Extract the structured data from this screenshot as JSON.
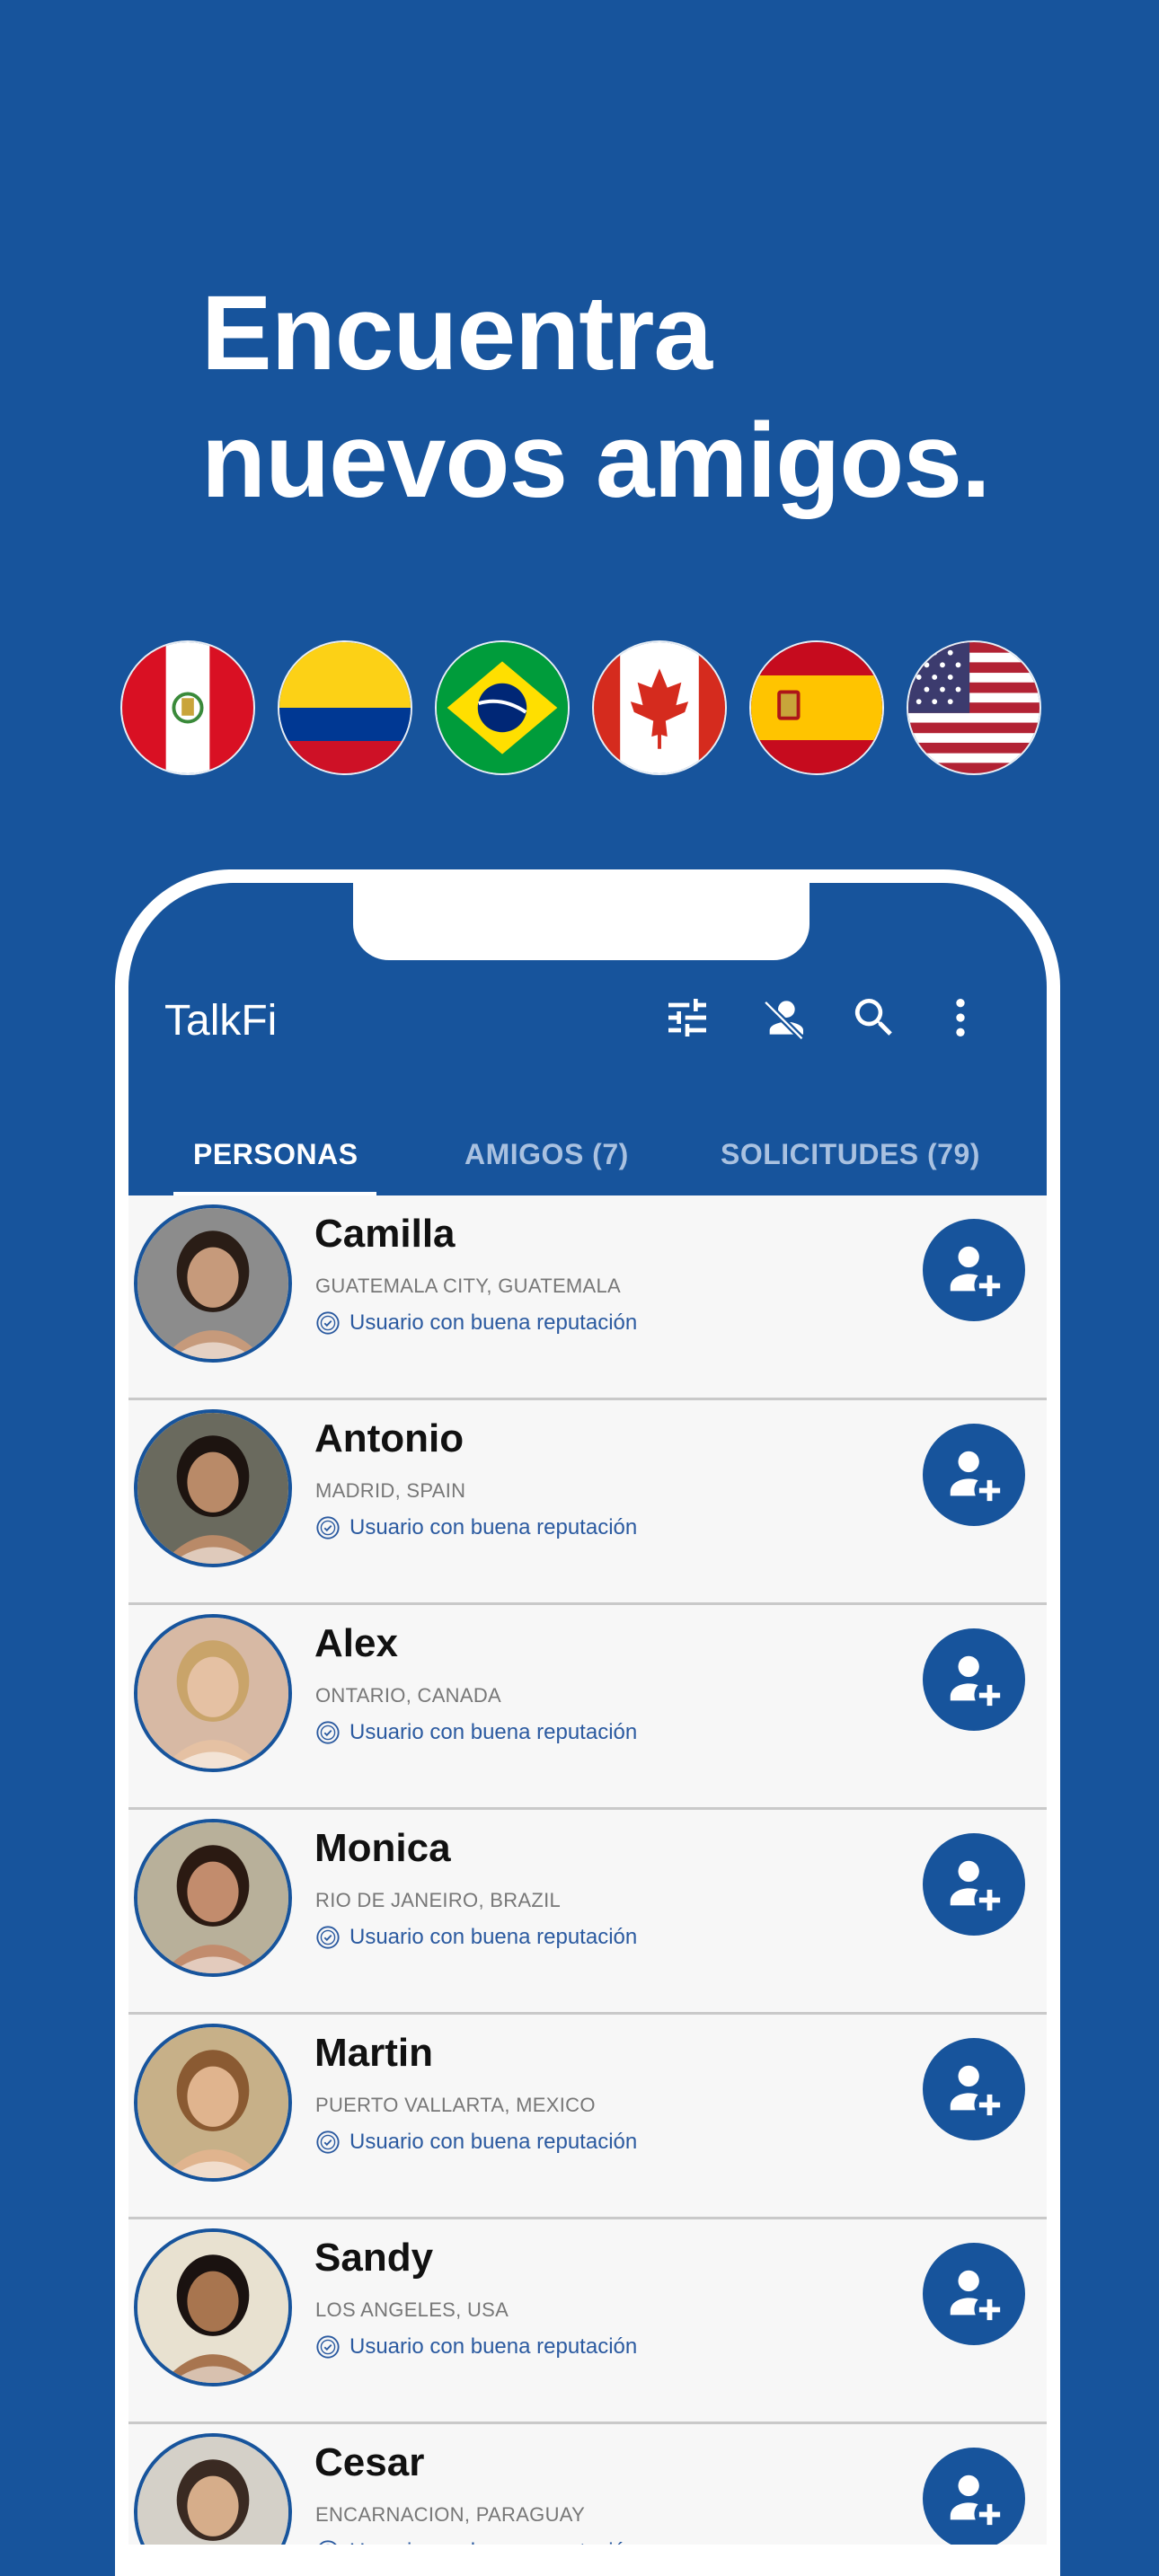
{
  "headline": {
    "line1": "Encuentra",
    "line2": "nuevos amigos."
  },
  "flags": [
    {
      "name": "peru-flag-icon"
    },
    {
      "name": "colombia-flag-icon"
    },
    {
      "name": "brazil-flag-icon"
    },
    {
      "name": "canada-flag-icon"
    },
    {
      "name": "spain-flag-icon"
    },
    {
      "name": "usa-flag-icon"
    }
  ],
  "app": {
    "title": "TalkFi",
    "toolbar_icons": [
      "filter-sliders-icon",
      "block-user-icon",
      "search-icon",
      "more-vert-icon"
    ],
    "tabs": [
      {
        "label": "PERSONAS",
        "active": true
      },
      {
        "label": "AMIGOS (7)",
        "active": false
      },
      {
        "label": "SOLICITUDES (79)",
        "active": false
      }
    ],
    "colors": {
      "primary": "#17549c",
      "background": "#f7f7f7",
      "reputation": "#2b5aa0"
    }
  },
  "people": [
    {
      "name": "Camilla",
      "location": "GUATEMALA CITY, GUATEMALA",
      "reputation": "Usuario con buena reputación"
    },
    {
      "name": "Antonio",
      "location": "MADRID, SPAIN",
      "reputation": "Usuario con buena reputación"
    },
    {
      "name": "Alex",
      "location": "ONTARIO, CANADA",
      "reputation": "Usuario con buena reputación"
    },
    {
      "name": "Monica",
      "location": "RIO DE JANEIRO, BRAZIL",
      "reputation": "Usuario con buena reputación"
    },
    {
      "name": "Martin",
      "location": "PUERTO VALLARTA, MEXICO",
      "reputation": "Usuario con buena reputación"
    },
    {
      "name": "Sandy",
      "location": "LOS ANGELES, USA",
      "reputation": "Usuario con buena reputación"
    },
    {
      "name": "Cesar",
      "location": "ENCARNACION, PARAGUAY",
      "reputation": "Usuario con buena reputación"
    }
  ]
}
